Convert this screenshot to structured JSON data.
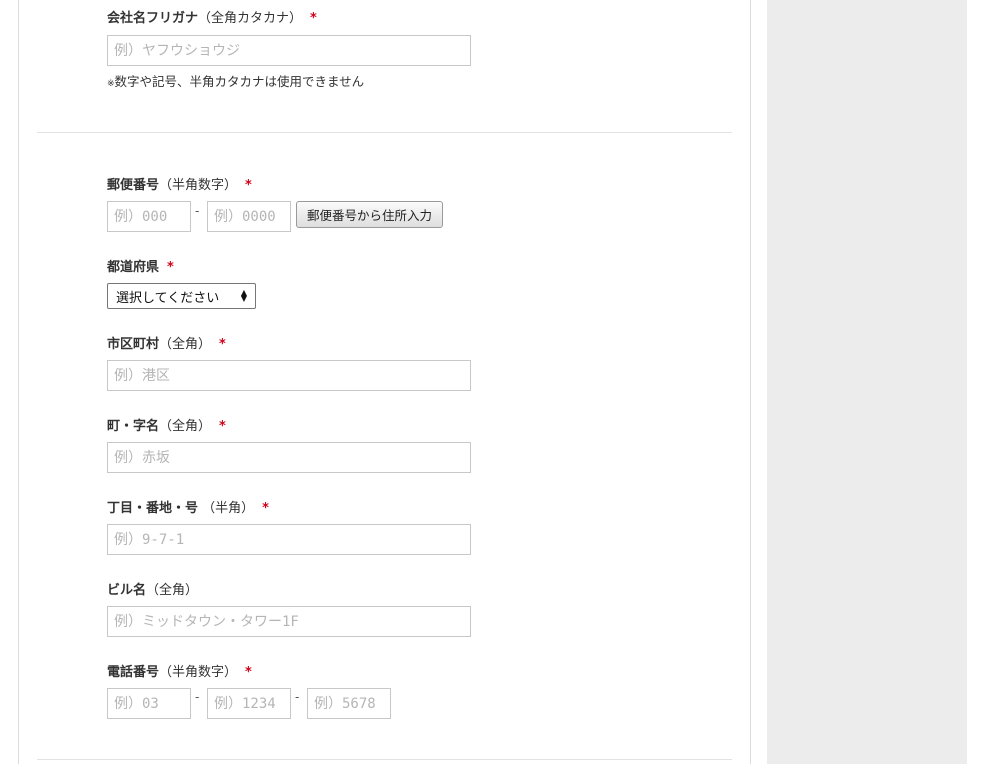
{
  "required_mark": "*",
  "dash": "-",
  "company_kana": {
    "label": "会社名フリガナ",
    "note": "（全角カタカナ）",
    "placeholder": "例）ヤフウショウジ",
    "help_star": "※",
    "help": "数字や記号、半角カタカナは使用できません"
  },
  "postal": {
    "label": "郵便番号",
    "note": "（半角数字）",
    "placeholder1": "例）000",
    "placeholder2": "例）0000",
    "lookup_button": "郵便番号から住所入力"
  },
  "prefecture": {
    "label": "都道府県",
    "selected": "選択してください",
    "arrow_up": "▲",
    "arrow_down": "▼"
  },
  "city": {
    "label": "市区町村",
    "note": "（全角）",
    "placeholder": "例）港区"
  },
  "town": {
    "label": "町・字名",
    "note": "（全角）",
    "placeholder": "例）赤坂"
  },
  "block": {
    "label": "丁目・番地・号",
    "note": " （半角）",
    "placeholder": "例）9-7-1"
  },
  "building": {
    "label": "ビル名",
    "note": "（全角）",
    "placeholder": "例）ミッドタウン・タワー1F"
  },
  "phone": {
    "label": "電話番号",
    "note": "（半角数字）",
    "placeholder1": "例）03",
    "placeholder2": "例）1234",
    "placeholder3": "例）5678"
  }
}
